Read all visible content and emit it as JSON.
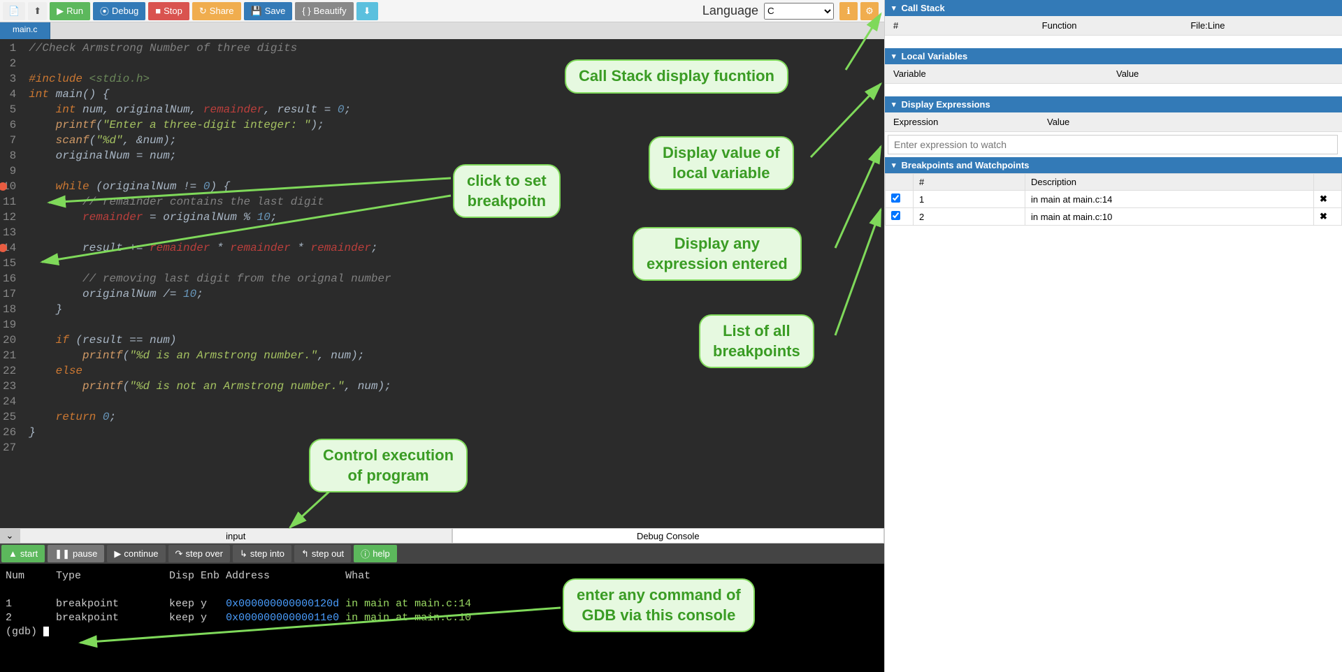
{
  "toolbar": {
    "run": "Run",
    "debug": "Debug",
    "stop": "Stop",
    "share": "Share",
    "save": "Save",
    "beautify": "Beautify",
    "language_label": "Language",
    "language_value": "C"
  },
  "tabs": {
    "filename": "main.c"
  },
  "code_lines": [
    "//Check Armstrong Number of three digits",
    "",
    "#include <stdio.h>",
    "int main() {",
    "    int num, originalNum, remainder, result = 0;",
    "    printf(\"Enter a three-digit integer: \");",
    "    scanf(\"%d\", &num);",
    "    originalNum = num;",
    "",
    "    while (originalNum != 0) {",
    "        // remainder contains the last digit",
    "        remainder = originalNum % 10;",
    "",
    "        result += remainder * remainder * remainder;",
    "",
    "        // removing last digit from the orignal number",
    "        originalNum /= 10;",
    "    }",
    "",
    "    if (result == num)",
    "        printf(\"%d is an Armstrong number.\", num);",
    "    else",
    "        printf(\"%d is not an Armstrong number.\", num);",
    "",
    "    return 0;",
    "}",
    ""
  ],
  "breakpoint_lines": [
    10,
    14
  ],
  "console_tabs": {
    "input": "input",
    "debug": "Debug Console"
  },
  "debug_controls": {
    "start": "start",
    "pause": "pause",
    "continue": "continue",
    "step_over": "step over",
    "step_into": "step into",
    "step_out": "step out",
    "help": "help"
  },
  "console_output": {
    "header": "Num     Type              Disp Enb Address            What",
    "rows": [
      {
        "num": "1",
        "type": "breakpoint",
        "disp": "keep",
        "enb": "y",
        "addr": "0x000000000000120d",
        "what": "in main at main.c:14"
      },
      {
        "num": "2",
        "type": "breakpoint",
        "disp": "keep",
        "enb": "y",
        "addr": "0x00000000000011e0",
        "what": "in main at main.c:10"
      }
    ],
    "prompt": "(gdb) "
  },
  "right_panels": {
    "call_stack": {
      "title": "Call Stack",
      "cols": [
        "#",
        "Function",
        "File:Line"
      ]
    },
    "locals": {
      "title": "Local Variables",
      "cols": [
        "Variable",
        "Value"
      ]
    },
    "expressions": {
      "title": "Display Expressions",
      "cols": [
        "Expression",
        "Value"
      ],
      "placeholder": "Enter expression to watch"
    },
    "breakpoints": {
      "title": "Breakpoints and Watchpoints",
      "cols": [
        "",
        "#",
        "Description",
        ""
      ],
      "rows": [
        {
          "checked": true,
          "num": "1",
          "desc": "in main at main.c:14"
        },
        {
          "checked": true,
          "num": "2",
          "desc": "in main at main.c:10"
        }
      ]
    }
  },
  "annotations": {
    "callstack": "Call Stack display fucntion",
    "locals": "Display value of\nlocal variable",
    "expr": "Display any\nexpression entered",
    "bps": "List of all\nbreakpoints",
    "click_bp": "click to set\nbreakpoitn",
    "control": "Control execution\nof program",
    "gdb": "enter any command of\nGDB via this console"
  }
}
